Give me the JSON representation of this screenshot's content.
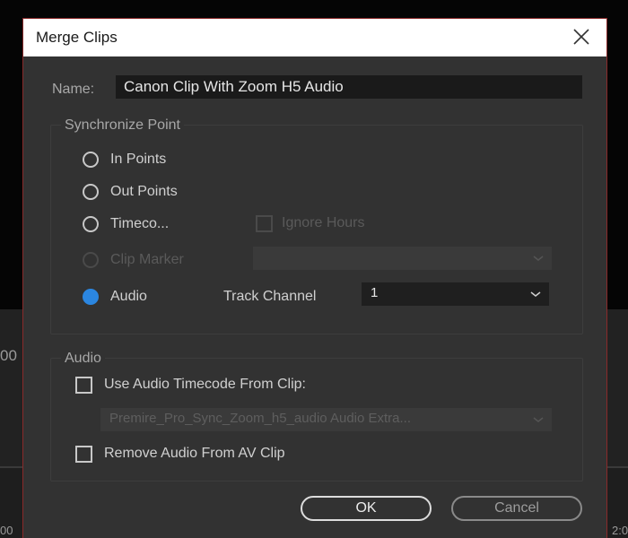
{
  "background": {
    "left_timecode_fragment": "00",
    "bottom_left_fragment": "00",
    "bottom_right_fragment": "2:0"
  },
  "dialog": {
    "title": "Merge Clips",
    "close_icon": "close-icon"
  },
  "name_field": {
    "label": "Name:",
    "value": "Canon Clip With Zoom H5 Audio"
  },
  "sync_point": {
    "group_title": "Synchronize Point",
    "options": [
      {
        "label": "In Points",
        "selected": false,
        "enabled": true
      },
      {
        "label": "Out Points",
        "selected": false,
        "enabled": true
      },
      {
        "label": "Timeco...",
        "selected": false,
        "enabled": true
      },
      {
        "label": "Clip Marker",
        "selected": false,
        "enabled": false
      },
      {
        "label": "Audio",
        "selected": true,
        "enabled": true
      }
    ],
    "ignore_hours_label": "Ignore Hours",
    "ignore_hours_checked": false,
    "clip_marker_select_value": "",
    "track_channel_label": "Track Channel",
    "track_channel_value": "1"
  },
  "audio": {
    "group_title": "Audio",
    "use_audio_timecode_label": "Use Audio Timecode From Clip:",
    "use_audio_timecode_checked": false,
    "audio_clip_select_value": "Premire_Pro_Sync_Zoom_h5_audio Audio Extra...",
    "remove_audio_label": "Remove Audio From AV Clip",
    "remove_audio_checked": false
  },
  "buttons": {
    "ok": "OK",
    "cancel": "Cancel"
  },
  "colors": {
    "selected_radio": "#2b86e0",
    "dialog_bg": "#323232",
    "dialog_border": "#8a2a2a"
  }
}
